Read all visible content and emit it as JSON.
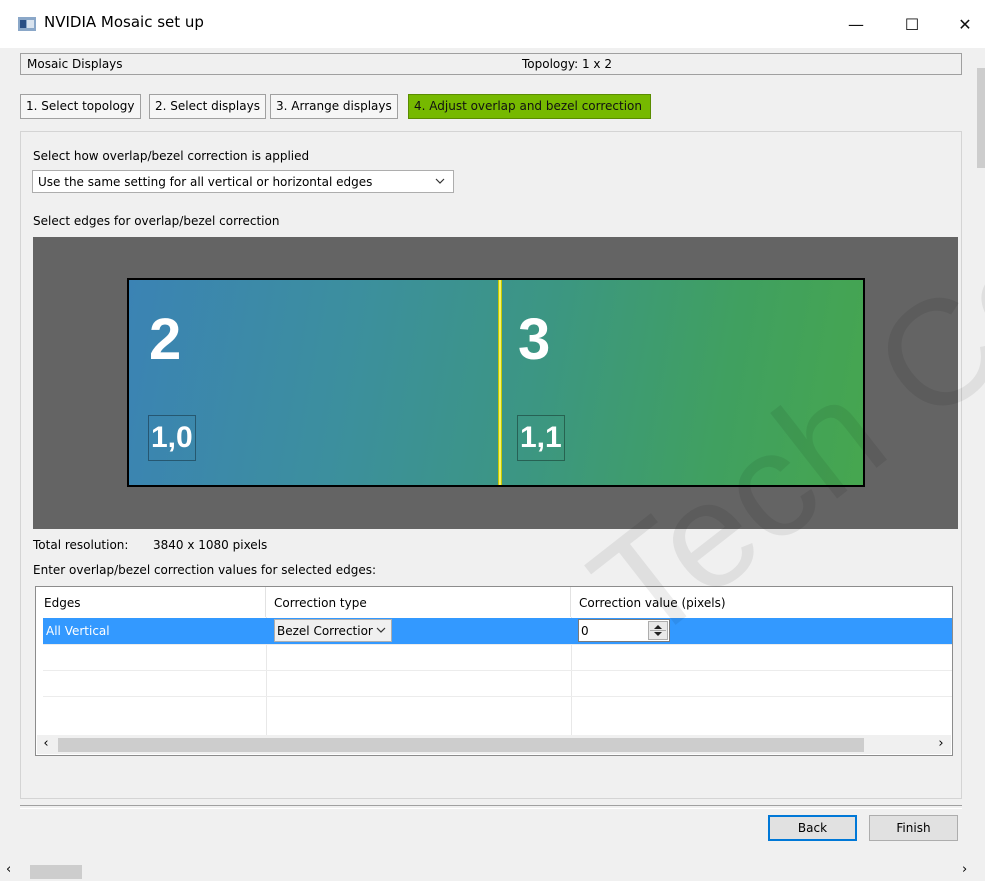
{
  "window": {
    "title": "NVIDIA Mosaic set up",
    "controls": {
      "minimize": "—",
      "maximize": "☐",
      "close": "✕"
    }
  },
  "header": {
    "section": "Mosaic Displays",
    "topology": "Topology: 1 x 2"
  },
  "tabs": [
    {
      "label": "1. Select topology",
      "active": false
    },
    {
      "label": "2. Select displays",
      "active": false
    },
    {
      "label": "3. Arrange displays",
      "active": false
    },
    {
      "label": "4. Adjust overlap and bezel correction",
      "active": true
    }
  ],
  "settings": {
    "apply_label": "Select how overlap/bezel correction is applied",
    "apply_value": "Use the same setting for all vertical or horizontal edges",
    "edges_label": "Select edges for overlap/bezel correction"
  },
  "displays": [
    {
      "number": "2",
      "coord": "1,0"
    },
    {
      "number": "3",
      "coord": "1,1"
    }
  ],
  "resolution": {
    "label": "Total resolution:",
    "value": "3840 x 1080 pixels"
  },
  "table": {
    "caption": "Enter overlap/bezel correction values for selected edges:",
    "columns": [
      "Edges",
      "Correction type",
      "Correction value (pixels)"
    ],
    "rows": [
      {
        "edge": "All Vertical",
        "type": "Bezel Correctior",
        "value": "0"
      }
    ]
  },
  "buttons": {
    "back": "Back",
    "finish": "Finish"
  },
  "watermark": "Tech Co., Lt",
  "icons": {
    "chevron": "chevron-down-icon",
    "spinner": "spinner-icon",
    "scroll_left": "scroll-left-icon",
    "scroll_right": "scroll-right-icon"
  },
  "colors": {
    "active_tab": "#76b900",
    "selection": "#3399ff",
    "bezel_edge": "#f3f36a",
    "canvas": "#646464"
  }
}
